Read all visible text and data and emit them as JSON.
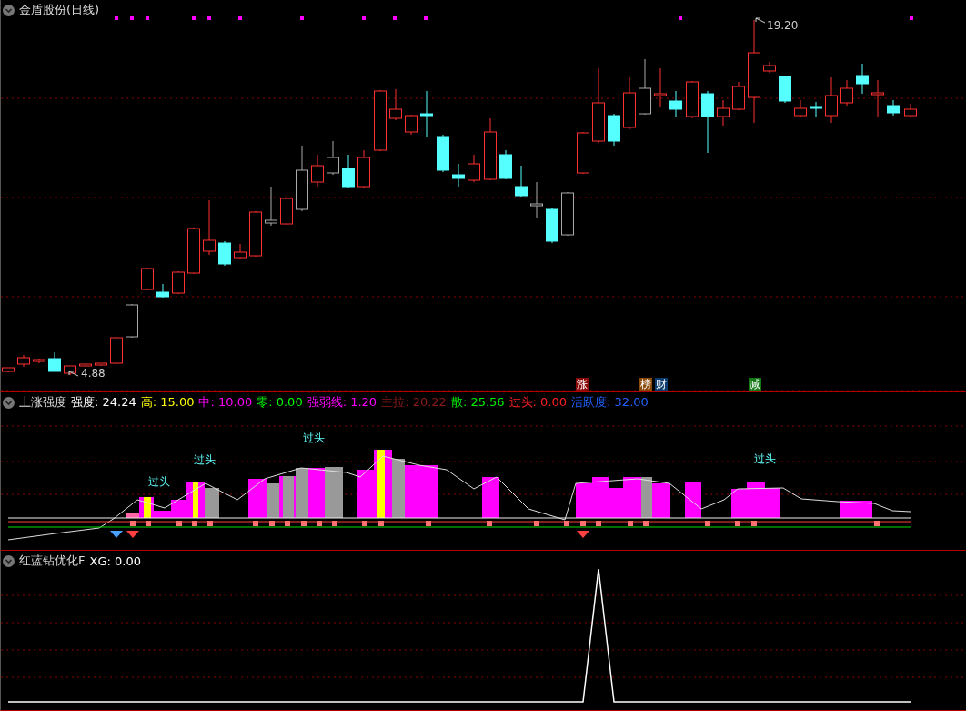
{
  "main_panel": {
    "title": "金盾股份(日线)",
    "price_labels": [
      {
        "kind": "high",
        "text": "19.20"
      },
      {
        "kind": "low",
        "text": "4.88"
      }
    ],
    "signal_tags": [
      {
        "text": "涨",
        "color": "#8b0a0a"
      },
      {
        "text": "榜",
        "color": "#8b4a0a"
      },
      {
        "text": "财",
        "color": "#0a3a6e"
      },
      {
        "text": "减",
        "color": "#157a15"
      }
    ]
  },
  "indicator_panel": {
    "title": "上涨强度",
    "readings": [
      {
        "label": "强度:",
        "value": "24.24",
        "color": "#ffffff"
      },
      {
        "label": "高:",
        "value": "15.00",
        "color": "#ffff00"
      },
      {
        "label": "中:",
        "value": "10.00",
        "color": "#ff00ff"
      },
      {
        "label": "零:",
        "value": "0.00",
        "color": "#00ff00"
      },
      {
        "label": "强弱线:",
        "value": "1.20",
        "color": "#ff00ff"
      },
      {
        "label": "主拉:",
        "value": "20.22",
        "color": "#8b1a1a"
      },
      {
        "label": "散:",
        "value": "25.56",
        "color": "#00ee00"
      },
      {
        "label": "过头:",
        "value": "0.00",
        "color": "#ff2020"
      },
      {
        "label": "活跃度:",
        "value": "32.00",
        "color": "#2060ff"
      }
    ],
    "annotations": [
      "过头",
      "过头",
      "过头",
      "过头"
    ]
  },
  "xg_panel": {
    "title": "红蓝钻优化F",
    "readings": [
      {
        "label": "XG:",
        "value": "0.00",
        "color": "#ffffff"
      }
    ]
  }
}
